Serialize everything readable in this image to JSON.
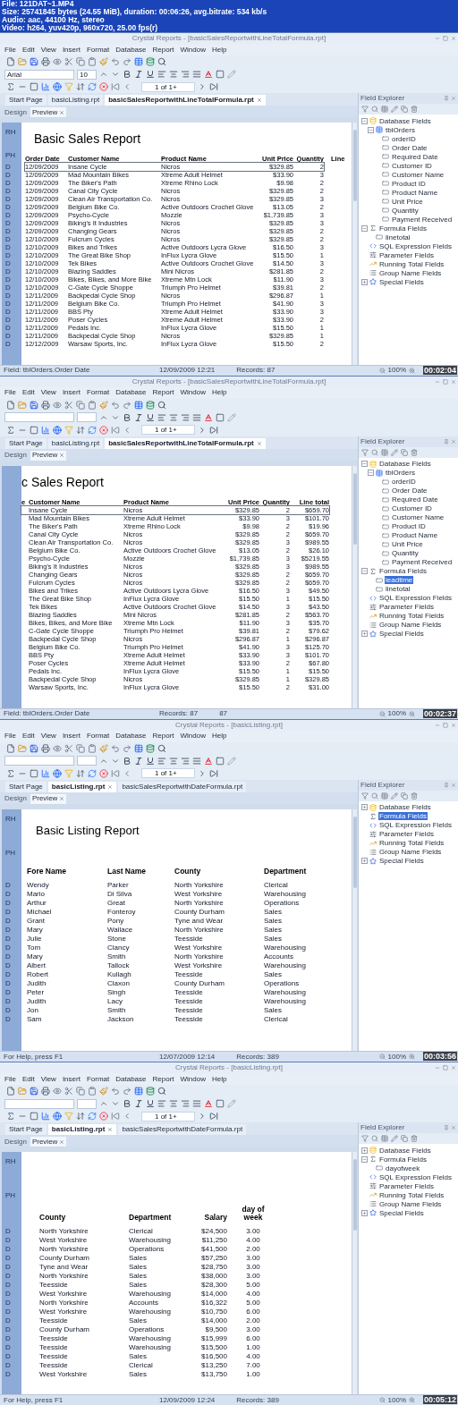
{
  "info": [
    "File: 121DAT~1.MP4",
    "Size: 25741845 bytes (24.55 MiB), duration: 00:06:26, avg.bitrate: 534 kb/s",
    "Audio: aac, 44100 Hz, stereo",
    "Video: h264, yuv420p, 960x720, 25.00 fps(r)"
  ],
  "frames": [
    {
      "window_title": "Crystal Reports - [basicSalesReportwithLineTotalFormula.rpt]",
      "menu": [
        "File",
        "Edit",
        "View",
        "Insert",
        "Format",
        "Database",
        "Report",
        "Window",
        "Help"
      ],
      "font_field": {
        "value": "Arial"
      },
      "size_field": {
        "value": "10"
      },
      "page_field": "1 of 1+",
      "tabs": [
        {
          "label": "Start Page",
          "selected": false
        },
        {
          "label": "basicListing.rpt",
          "selected": false
        },
        {
          "label": "basicSalesReportwithLineTotalFormula.rpt",
          "selected": true
        }
      ],
      "view_tabs": [
        {
          "label": "Design",
          "selected": false
        },
        {
          "label": "Preview",
          "selected": true
        }
      ],
      "field_explorer": {
        "title": "Field Explorer",
        "tree": [
          {
            "kind": "database",
            "label": "Database Fields",
            "expanded": true,
            "selected": false,
            "children": [
              {
                "kind": "table",
                "label": "tblOrders",
                "expanded": true,
                "selected": false,
                "children": [
                  {
                    "kind": "field",
                    "label": "orderID",
                    "selected": false
                  },
                  {
                    "kind": "field",
                    "label": "Order Date",
                    "selected": false
                  },
                  {
                    "kind": "field",
                    "label": "Required Date",
                    "selected": false
                  },
                  {
                    "kind": "field",
                    "label": "Customer ID",
                    "selected": false
                  },
                  {
                    "kind": "field",
                    "label": "Customer Name",
                    "selected": false
                  },
                  {
                    "kind": "field",
                    "label": "Product ID",
                    "selected": false
                  },
                  {
                    "kind": "field",
                    "label": "Product Name",
                    "selected": false
                  },
                  {
                    "kind": "field",
                    "label": "Unit Price",
                    "selected": false
                  },
                  {
                    "kind": "field",
                    "label": "Quantity",
                    "selected": false
                  },
                  {
                    "kind": "field",
                    "label": "Payment Received",
                    "selected": false
                  }
                ]
              }
            ]
          },
          {
            "kind": "formula",
            "label": "Formula Fields",
            "expanded": true,
            "selected": false,
            "children": [
              {
                "kind": "field",
                "label": "linetotal",
                "selected": false
              }
            ]
          },
          {
            "kind": "sql",
            "label": "SQL Expression Fields",
            "selected": false
          },
          {
            "kind": "parameter",
            "label": "Parameter Fields",
            "selected": false
          },
          {
            "kind": "running",
            "label": "Running Total Fields",
            "selected": false
          },
          {
            "kind": "group",
            "label": "Group Name Fields",
            "selected": false
          },
          {
            "kind": "special",
            "label": "Special Fields",
            "expanded": false,
            "selected": false
          }
        ]
      },
      "report": {
        "kind": "orders",
        "title": "Basic Sales Report",
        "title_section": "RH",
        "header_section": "PH",
        "columns": [
          "Order Date",
          "Customer Name",
          "Product Name",
          "Unit Price",
          "Quantity",
          "Line"
        ],
        "rows": [
          {
            "section": "D",
            "selected": true,
            "cells": [
              "12/09/2009",
              "Insane Cycle",
              "Nicros",
              "$329.85",
              "2"
            ]
          },
          {
            "section": "D",
            "selected": false,
            "cells": [
              "12/09/2009",
              "Mad Mountain Bikes",
              "Xtreme Adult Helmet",
              "$33.90",
              "3"
            ]
          },
          {
            "section": "D",
            "selected": false,
            "cells": [
              "12/09/2009",
              "The Biker's Path",
              "Xtreme Rhino Lock",
              "$9.98",
              "2"
            ]
          },
          {
            "section": "D",
            "selected": false,
            "cells": [
              "12/09/2009",
              "Canal City Cycle",
              "Nicros",
              "$329.85",
              "2"
            ]
          },
          {
            "section": "D",
            "selected": false,
            "cells": [
              "12/09/2009",
              "Clean Air Transportation Co.",
              "Nicros",
              "$329.85",
              "3"
            ]
          },
          {
            "section": "D",
            "selected": false,
            "cells": [
              "12/09/2009",
              "Belgium Bike Co.",
              "Active Outdoors Crochet Glove",
              "$13.05",
              "2"
            ]
          },
          {
            "section": "D",
            "selected": false,
            "cells": [
              "12/09/2009",
              "Psycho-Cycle",
              "Mozzie",
              "$1,739.85",
              "3"
            ]
          },
          {
            "section": "D",
            "selected": false,
            "cells": [
              "12/09/2009",
              "Biking's It Industries",
              "Nicros",
              "$329.85",
              "3"
            ]
          },
          {
            "section": "D",
            "selected": false,
            "cells": [
              "12/09/2009",
              "Changing Gears",
              "Nicros",
              "$329.85",
              "2"
            ]
          },
          {
            "section": "D",
            "selected": false,
            "cells": [
              "12/10/2009",
              "Fulcrum Cycles",
              "Nicros",
              "$329.85",
              "2"
            ]
          },
          {
            "section": "D",
            "selected": false,
            "cells": [
              "12/10/2009",
              "Bikes and Trikes",
              "Active Outdoors Lycra Glove",
              "$16.50",
              "3"
            ]
          },
          {
            "section": "D",
            "selected": false,
            "cells": [
              "12/10/2009",
              "The Great Bike Shop",
              "InFlux Lycra Glove",
              "$15.50",
              "1"
            ]
          },
          {
            "section": "D",
            "selected": false,
            "cells": [
              "12/10/2009",
              "Tek Bikes",
              "Active Outdoors Crochet Glove",
              "$14.50",
              "3"
            ]
          },
          {
            "section": "D",
            "selected": false,
            "cells": [
              "12/10/2009",
              "Blazing Saddles",
              "Mini Nicros",
              "$281.85",
              "2"
            ]
          },
          {
            "section": "D",
            "selected": false,
            "cells": [
              "12/10/2009",
              "Bikes, Bikes, and More Bike",
              "Xtreme Mtn Lock",
              "$11.90",
              "3"
            ]
          },
          {
            "section": "D",
            "selected": false,
            "cells": [
              "12/10/2009",
              "C-Gate Cycle Shoppe",
              "Triumph Pro Helmet",
              "$39.81",
              "2"
            ]
          },
          {
            "section": "D",
            "selected": false,
            "cells": [
              "12/11/2009",
              "Backpedal Cycle Shop",
              "Nicros",
              "$296.87",
              "1"
            ]
          },
          {
            "section": "D",
            "selected": false,
            "cells": [
              "12/11/2009",
              "Belgium Bike Co.",
              "Triumph Pro Helmet",
              "$41.90",
              "3"
            ]
          },
          {
            "section": "D",
            "selected": false,
            "cells": [
              "12/11/2009",
              "BBS Pty",
              "Xtreme Adult Helmet",
              "$33.90",
              "3"
            ]
          },
          {
            "section": "D",
            "selected": false,
            "cells": [
              "12/11/2009",
              "Poser Cycles",
              "Xtreme Adult Helmet",
              "$33.90",
              "2"
            ]
          },
          {
            "section": "D",
            "selected": false,
            "cells": [
              "12/11/2009",
              "Pedals Inc.",
              "InFlux Lycra Glove",
              "$15.50",
              "1"
            ]
          },
          {
            "section": "D",
            "selected": false,
            "cells": [
              "12/11/2009",
              "Backpedal Cycle Shop",
              "Nicros",
              "$329.85",
              "1"
            ]
          },
          {
            "section": "D",
            "selected": false,
            "cells": [
              "12/12/2009",
              "Warsaw Sports, Inc.",
              "InFlux Lycra Glove",
              "$15.50",
              "2"
            ]
          }
        ]
      },
      "status_bar": {
        "items": [
          "Field: tblOrders.Order Date",
          "12/09/2009 12:21",
          "Records: 87"
        ],
        "zoom": "100%"
      },
      "timestamp": "00:02:04"
    },
    {
      "window_title": "Crystal Reports - [basicSalesReportwithLineTotalFormula.rpt]",
      "menu": [
        "File",
        "Edit",
        "View",
        "Insert",
        "Format",
        "Database",
        "Report",
        "Window",
        "Help"
      ],
      "page_field": "1 of 1+",
      "tabs": [
        {
          "label": "Start Page",
          "selected": false
        },
        {
          "label": "basicListing.rpt",
          "selected": false
        },
        {
          "label": "basicSalesReportwithLineTotalFormula.rpt",
          "selected": true
        }
      ],
      "view_tabs": [
        {
          "label": "Design",
          "selected": false
        },
        {
          "label": "Preview",
          "selected": true
        }
      ],
      "field_explorer": {
        "title": "Field Explorer",
        "tree": [
          {
            "kind": "database",
            "label": "Database Fields",
            "expanded": true,
            "selected": false,
            "children": [
              {
                "kind": "table",
                "label": "tblOrders",
                "expanded": true,
                "selected": false,
                "children": [
                  {
                    "kind": "field",
                    "label": "orderID",
                    "selected": false
                  },
                  {
                    "kind": "field",
                    "label": "Order Date",
                    "selected": false
                  },
                  {
                    "kind": "field",
                    "label": "Required Date",
                    "selected": false
                  },
                  {
                    "kind": "field",
                    "label": "Customer ID",
                    "selected": false
                  },
                  {
                    "kind": "field",
                    "label": "Customer Name",
                    "selected": false
                  },
                  {
                    "kind": "field",
                    "label": "Product ID",
                    "selected": false
                  },
                  {
                    "kind": "field",
                    "label": "Product Name",
                    "selected": false
                  },
                  {
                    "kind": "field",
                    "label": "Unit Price",
                    "selected": false
                  },
                  {
                    "kind": "field",
                    "label": "Quantity",
                    "selected": false
                  },
                  {
                    "kind": "field",
                    "label": "Payment Received",
                    "selected": false
                  }
                ]
              }
            ]
          },
          {
            "kind": "formula",
            "label": "Formula Fields",
            "expanded": true,
            "selected": false,
            "children": [
              {
                "kind": "field",
                "label": "leadtime",
                "selected": true
              },
              {
                "kind": "field",
                "label": "linetotal",
                "selected": false
              }
            ]
          },
          {
            "kind": "sql",
            "label": "SQL Expression Fields",
            "selected": false
          },
          {
            "kind": "parameter",
            "label": "Parameter Fields",
            "selected": false
          },
          {
            "kind": "running",
            "label": "Running Total Fields",
            "selected": false
          },
          {
            "kind": "group",
            "label": "Group Name Fields",
            "selected": false
          },
          {
            "kind": "special",
            "label": "Special Fields",
            "expanded": false,
            "selected": false
          }
        ]
      },
      "report": {
        "kind": "linetotal",
        "title": "c Sales Report",
        "columns": [
          "e",
          "Customer Name",
          "Product Name",
          "Unit Price",
          "Quantity",
          "Line total"
        ],
        "rows": [
          {
            "selected": true,
            "cells": [
              "",
              "Insane Cycle",
              "Nicros",
              "$329.85",
              "2",
              "$659.70"
            ]
          },
          {
            "selected": false,
            "cells": [
              "",
              "Mad Mountain Bikes",
              "Xtreme Adult Helmet",
              "$33.90",
              "3",
              "$101.70"
            ]
          },
          {
            "selected": false,
            "cells": [
              "",
              "The Biker's Path",
              "Xtreme Rhino Lock",
              "$9.98",
              "2",
              "$19.96"
            ]
          },
          {
            "selected": false,
            "cells": [
              "",
              "Canal City Cycle",
              "Nicros",
              "$329.85",
              "2",
              "$659.70"
            ]
          },
          {
            "selected": false,
            "cells": [
              "",
              "Clean Air Transportation Co.",
              "Nicros",
              "$329.85",
              "3",
              "$989.55"
            ]
          },
          {
            "selected": false,
            "cells": [
              "",
              "Belgium Bike Co.",
              "Active Outdoors Crochet Glove",
              "$13.05",
              "2",
              "$26.10"
            ]
          },
          {
            "selected": false,
            "cells": [
              "",
              "Psycho-Cycle",
              "Mozzie",
              "$1,739.85",
              "3",
              "$5219.55"
            ]
          },
          {
            "selected": false,
            "cells": [
              "",
              "Biking's It Industries",
              "Nicros",
              "$329.85",
              "3",
              "$989.55"
            ]
          },
          {
            "selected": false,
            "cells": [
              "",
              "Changing Gears",
              "Nicros",
              "$329.85",
              "2",
              "$659.70"
            ]
          },
          {
            "selected": false,
            "cells": [
              "",
              "Fulcrum Cycles",
              "Nicros",
              "$329.85",
              "2",
              "$659.70"
            ]
          },
          {
            "selected": false,
            "cells": [
              "",
              "Bikes and Trikes",
              "Active Outdoors Lycra Glove",
              "$16.50",
              "3",
              "$49.50"
            ]
          },
          {
            "selected": false,
            "cells": [
              "",
              "The Great Bike Shop",
              "InFlux Lycra Glove",
              "$15.50",
              "1",
              "$15.50"
            ]
          },
          {
            "selected": false,
            "cells": [
              "",
              "Tek Bikes",
              "Active Outdoors Crochet Glove",
              "$14.50",
              "3",
              "$43.50"
            ]
          },
          {
            "selected": false,
            "cells": [
              "",
              "Blazing Saddles",
              "Mini Nicros",
              "$281.85",
              "2",
              "$563.70"
            ]
          },
          {
            "selected": false,
            "cells": [
              "",
              "Bikes, Bikes, and More Bike",
              "Xtreme Mtn Lock",
              "$11.90",
              "3",
              "$35.70"
            ]
          },
          {
            "selected": false,
            "cells": [
              "",
              "C-Gate Cycle Shoppe",
              "Triumph Pro Helmet",
              "$39.81",
              "2",
              "$79.62"
            ]
          },
          {
            "selected": false,
            "cells": [
              "",
              "Backpedal Cycle Shop",
              "Nicros",
              "$296.87",
              "1",
              "$296.87"
            ]
          },
          {
            "selected": false,
            "cells": [
              "",
              "Belgium Bike Co.",
              "Triumph Pro Helmet",
              "$41.90",
              "3",
              "$125.70"
            ]
          },
          {
            "selected": false,
            "cells": [
              "",
              "BBS Pty",
              "Xtreme Adult Helmet",
              "$33.90",
              "3",
              "$101.70"
            ]
          },
          {
            "selected": false,
            "cells": [
              "",
              "Poser Cycles",
              "Xtreme Adult Helmet",
              "$33.90",
              "2",
              "$67.80"
            ]
          },
          {
            "selected": false,
            "cells": [
              "",
              "Pedals Inc.",
              "InFlux Lycra Glove",
              "$15.50",
              "1",
              "$15.50"
            ]
          },
          {
            "selected": false,
            "cells": [
              "",
              "Backpedal Cycle Shop",
              "Nicros",
              "$329.85",
              "1",
              "$329.85"
            ]
          },
          {
            "selected": false,
            "cells": [
              "",
              "Warsaw Sports, Inc.",
              "InFlux Lycra Glove",
              "$15.50",
              "2",
              "$31.00"
            ]
          }
        ]
      },
      "status_bar": {
        "items": [
          "Field: tblOrders.Order Date",
          "Records: 87",
          "87"
        ],
        "zoom": "100%"
      },
      "timestamp": "00:02:37"
    },
    {
      "window_title": "Crystal Reports - [basicListing.rpt]",
      "menu": [
        "File",
        "Edit",
        "View",
        "Insert",
        "Format",
        "Database",
        "Report",
        "Window",
        "Help"
      ],
      "page_field": "1 of 1+",
      "tabs": [
        {
          "label": "Start Page",
          "selected": false
        },
        {
          "label": "basicListing.rpt",
          "selected": true
        },
        {
          "label": "basicSalesReportwithDateFormula.rpt",
          "selected": false
        }
      ],
      "view_tabs": [
        {
          "label": "Design",
          "selected": false
        },
        {
          "label": "Preview",
          "selected": true
        }
      ],
      "field_explorer": {
        "title": "Field Explorer",
        "tree": [
          {
            "kind": "database",
            "label": "Database Fields",
            "expanded": false,
            "selected": false
          },
          {
            "kind": "formula",
            "label": "Formula Fields",
            "selected": true
          },
          {
            "kind": "sql",
            "label": "SQL Expression Fields",
            "selected": false
          },
          {
            "kind": "parameter",
            "label": "Parameter Fields",
            "selected": false
          },
          {
            "kind": "running",
            "label": "Running Total Fields",
            "selected": false
          },
          {
            "kind": "group",
            "label": "Group Name Fields",
            "selected": false
          },
          {
            "kind": "special",
            "label": "Special Fields",
            "expanded": false,
            "selected": false
          }
        ]
      },
      "report": {
        "kind": "listing",
        "title": "Basic Listing Report",
        "title_section": "RH",
        "header_section": "PH",
        "columns": [
          "Fore Name",
          "Last Name",
          "County",
          "Department"
        ],
        "rows": [
          {
            "section": "D",
            "cells": [
              "Wendy",
              "Parker",
              "North Yorkshire",
              "Clerical"
            ]
          },
          {
            "section": "D",
            "cells": [
              "Mario",
              "Di Silva",
              "West Yorkshire",
              "Warehousing"
            ]
          },
          {
            "section": "D",
            "cells": [
              "Arthur",
              "Great",
              "North Yorkshire",
              "Operations"
            ]
          },
          {
            "section": "D",
            "cells": [
              "Michael",
              "Fonteroy",
              "County Durham",
              "Sales"
            ]
          },
          {
            "section": "D",
            "cells": [
              "Grant",
              "Pony",
              "Tyne and Wear",
              "Sales"
            ]
          },
          {
            "section": "D",
            "cells": [
              "Mary",
              "Wallace",
              "North Yorkshire",
              "Sales"
            ]
          },
          {
            "section": "D",
            "cells": [
              "Julie",
              "Stone",
              "Teesside",
              "Sales"
            ]
          },
          {
            "section": "D",
            "cells": [
              "Tom",
              "Clancy",
              "West Yorkshire",
              "Warehousing"
            ]
          },
          {
            "section": "D",
            "cells": [
              "Mary",
              "Smith",
              "North Yorkshire",
              "Accounts"
            ]
          },
          {
            "section": "D",
            "cells": [
              "Albert",
              "Tallock",
              "West Yorkshire",
              "Warehousing"
            ]
          },
          {
            "section": "D",
            "cells": [
              "Robert",
              "Kullagh",
              "Teesside",
              "Sales"
            ]
          },
          {
            "section": "D",
            "cells": [
              "Judith",
              "Claxon",
              "County Durham",
              "Operations"
            ]
          },
          {
            "section": "D",
            "cells": [
              "Peter",
              "Singh",
              "Teesside",
              "Warehousing"
            ]
          },
          {
            "section": "D",
            "cells": [
              "Judith",
              "Lacy",
              "Teesside",
              "Warehousing"
            ]
          },
          {
            "section": "D",
            "cells": [
              "Jon",
              "Smith",
              "Teesside",
              "Sales"
            ]
          },
          {
            "section": "D",
            "cells": [
              "Sam",
              "Jackson",
              "Teesside",
              "Clerical"
            ]
          }
        ]
      },
      "status_bar": {
        "items": [
          "For Help, press F1",
          "12/07/2009 12:14",
          "Records: 389"
        ],
        "zoom": "100%"
      },
      "timestamp": "00:03:56"
    },
    {
      "window_title": "Crystal Reports - [basicListing.rpt]",
      "menu": [
        "File",
        "Edit",
        "View",
        "Insert",
        "Format",
        "Database",
        "Report",
        "Window",
        "Help"
      ],
      "page_field": "1 of 1+",
      "tabs": [
        {
          "label": "Start Page",
          "selected": false
        },
        {
          "label": "basicListing.rpt",
          "selected": true
        },
        {
          "label": "basicSalesReportwithDateFormula.rpt",
          "selected": false
        }
      ],
      "view_tabs": [
        {
          "label": "Design",
          "selected": false
        },
        {
          "label": "Preview",
          "selected": true
        }
      ],
      "field_explorer": {
        "title": "Field Explorer",
        "tree": [
          {
            "kind": "database",
            "label": "Database Fields",
            "expanded": false,
            "selected": false
          },
          {
            "kind": "formula",
            "label": "Formula Fields",
            "expanded": true,
            "selected": false,
            "children": [
              {
                "kind": "field",
                "label": "dayofweek",
                "selected": false
              }
            ]
          },
          {
            "kind": "sql",
            "label": "SQL Expression Fields",
            "selected": false
          },
          {
            "kind": "parameter",
            "label": "Parameter Fields",
            "selected": false
          },
          {
            "kind": "running",
            "label": "Running Total Fields",
            "selected": false
          },
          {
            "kind": "group",
            "label": "Group Name Fields",
            "selected": false
          },
          {
            "kind": "special",
            "label": "Special Fields",
            "expanded": false,
            "selected": false
          }
        ]
      },
      "report": {
        "kind": "salary",
        "title_section": "RH",
        "header_section": "PH",
        "columns": [
          "County",
          "Department",
          "Salary",
          "day of week"
        ],
        "rows": [
          {
            "section": "D",
            "cells": [
              "North Yorkshire",
              "Clerical",
              "$24,500",
              "3.00"
            ]
          },
          {
            "section": "D",
            "cells": [
              "West Yorkshire",
              "Warehousing",
              "$11,250",
              "4.00"
            ]
          },
          {
            "section": "D",
            "cells": [
              "North Yorkshire",
              "Operations",
              "$41,500",
              "2.00"
            ]
          },
          {
            "section": "D",
            "cells": [
              "County Durham",
              "Sales",
              "$57,250",
              "3.00"
            ]
          },
          {
            "section": "D",
            "cells": [
              "Tyne and Wear",
              "Sales",
              "$28,750",
              "3.00"
            ]
          },
          {
            "section": "D",
            "cells": [
              "North Yorkshire",
              "Sales",
              "$38,000",
              "3.00"
            ]
          },
          {
            "section": "D",
            "cells": [
              "Teesside",
              "Sales",
              "$28,300",
              "5.00"
            ]
          },
          {
            "section": "D",
            "cells": [
              "West Yorkshire",
              "Warehousing",
              "$14,000",
              "4.00"
            ]
          },
          {
            "section": "D",
            "cells": [
              "North Yorkshire",
              "Accounts",
              "$16,322",
              "5.00"
            ]
          },
          {
            "section": "D",
            "cells": [
              "West Yorkshire",
              "Warehousing",
              "$10,750",
              "6.00"
            ]
          },
          {
            "section": "D",
            "cells": [
              "Teesside",
              "Sales",
              "$14,000",
              "2.00"
            ]
          },
          {
            "section": "D",
            "cells": [
              "County Durham",
              "Operations",
              "$9,500",
              "3.00"
            ]
          },
          {
            "section": "D",
            "cells": [
              "Teesside",
              "Warehousing",
              "$15,999",
              "6.00"
            ]
          },
          {
            "section": "D",
            "cells": [
              "Teesside",
              "Warehousing",
              "$15,500",
              "1.00"
            ]
          },
          {
            "section": "D",
            "cells": [
              "Teesside",
              "Sales",
              "$16,500",
              "4.00"
            ]
          },
          {
            "section": "D",
            "cells": [
              "Teesside",
              "Clerical",
              "$13,250",
              "7.00"
            ]
          },
          {
            "section": "D",
            "cells": [
              "West Yorkshire",
              "Sales",
              "$13,750",
              "1.00"
            ]
          }
        ]
      },
      "status_bar": {
        "items": [
          "For Help, press F1",
          "12/09/2009 12:24",
          "Records: 389"
        ],
        "zoom": "100%"
      },
      "timestamp": "00:05:12"
    }
  ]
}
